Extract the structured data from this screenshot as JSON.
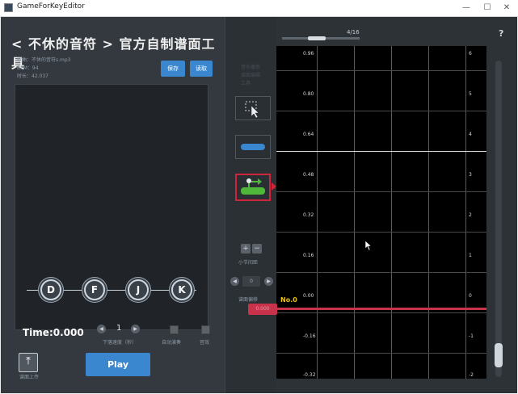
{
  "window": {
    "title": "GameForKeyEditor",
    "minimize": "—",
    "maximize": "☐",
    "close": "✕"
  },
  "header": {
    "title": "< 不休的音符 > 官方自制谱面工具"
  },
  "song": {
    "name_label": "歌曲：不休的音符s.mp3",
    "bpm_label": "BPM：94",
    "duration_label": "时长：42.037"
  },
  "buttons": {
    "save": "保存",
    "read": "读取",
    "play": "Play",
    "upload": "谱面上传"
  },
  "keys": [
    "D",
    "F",
    "J",
    "K"
  ],
  "playback": {
    "time": "Time:0.000",
    "speed_value": "1",
    "speed_label": "下落速度（秒）",
    "auto_play_label": "自动演奏",
    "sound_label": "音效",
    "dec": "◀",
    "inc": "▶"
  },
  "tools": {
    "faint_labels": [
      "音乐播放",
      "谱面编辑",
      "工具"
    ],
    "plus": "+",
    "minus": "−",
    "measure_label": "小节间距",
    "offset_value": "0",
    "offset_label": "谱面偏移"
  },
  "timeline": {
    "page": "4/16",
    "help": "?",
    "marker": "No.0",
    "marker_value": "0.000",
    "left_ticks": [
      "0.96",
      "0.80",
      "0.64",
      "0.48",
      "0.32",
      "0.16",
      "0.00",
      "-0.16",
      "-0.32"
    ],
    "right_ticks": [
      "6",
      "5",
      "4",
      "3",
      "2",
      "1",
      "0",
      "-1",
      "-2"
    ]
  },
  "colors": {
    "accent": "#3a86cf",
    "marker": "#c8324a",
    "marker_label": "#e8c21a",
    "tool_selected": "#d0243a"
  }
}
